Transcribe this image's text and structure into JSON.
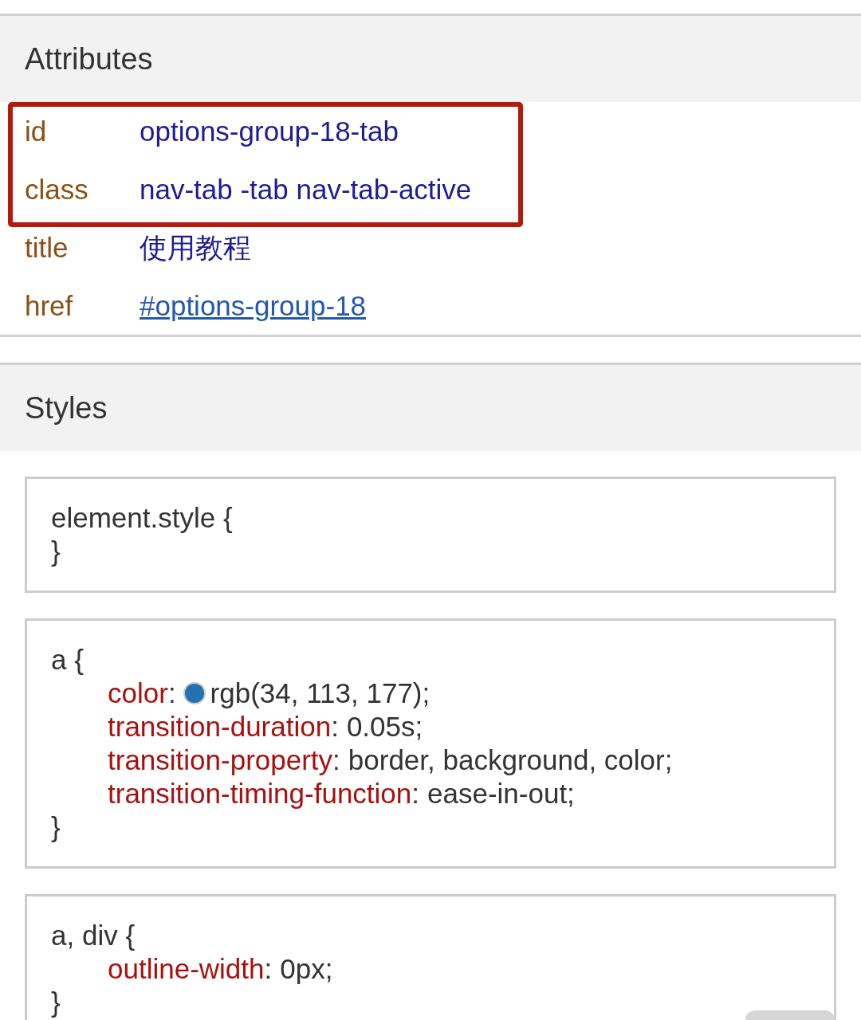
{
  "attributes_panel": {
    "title": "Attributes",
    "attributes": [
      {
        "name": "id",
        "value": "options-group-18-tab",
        "kind": "text",
        "highlighted": true
      },
      {
        "name": "class",
        "value": "nav-tab -tab nav-tab-active",
        "kind": "text",
        "highlighted": true
      },
      {
        "name": "title",
        "value": "使用教程",
        "kind": "text",
        "highlighted": false
      },
      {
        "name": "href",
        "value": "#options-group-18",
        "kind": "link",
        "highlighted": false
      }
    ]
  },
  "styles_panel": {
    "title": "Styles",
    "rules": [
      {
        "selector": "element.style {",
        "closing": "}"
      },
      {
        "selector": "a {",
        "declarations": [
          {
            "property": "color",
            "colon": ":",
            "color": "#2271b1",
            "value": "rgb(34, 113, 177);"
          },
          {
            "property": "transition-duration",
            "colon": ":",
            "value": "0.05s;"
          },
          {
            "property": "transition-property",
            "colon": ":",
            "value": "border, background, color;"
          },
          {
            "property": "transition-timing-function",
            "colon": ":",
            "value": "ease-in-out;"
          }
        ],
        "closing": "}"
      },
      {
        "selector": "a, div {",
        "declarations": [
          {
            "property": "outline-width",
            "colon": ":",
            "value": "0px;"
          }
        ],
        "closing": "}"
      }
    ]
  }
}
